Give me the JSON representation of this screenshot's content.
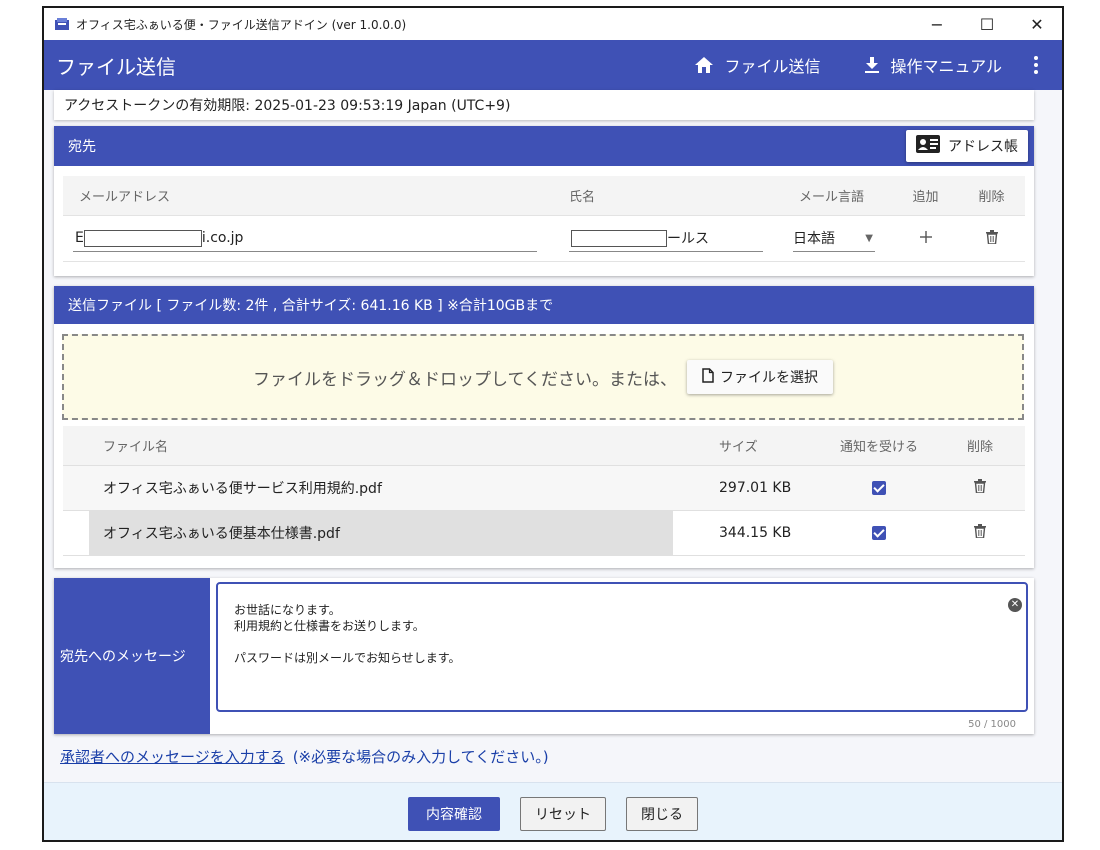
{
  "window": {
    "title": "オフィス宅ふぁいる便・ファイル送信アドイン (ver 1.0.0.0)",
    "minimize": "−",
    "maximize": "☐",
    "close": "✕"
  },
  "appbar": {
    "title": "ファイル送信",
    "nav_send": "ファイル送信",
    "nav_manual": "操作マニュアル"
  },
  "token": {
    "text": "アクセストークンの有効期限: 2025-01-23 09:53:19 Japan (UTC+9)"
  },
  "recipients": {
    "header": "宛先",
    "address_book": "アドレス帳",
    "columns": {
      "email": "メールアドレス",
      "name": "氏名",
      "lang": "メール言語",
      "add": "追加",
      "del": "削除"
    },
    "rows": [
      {
        "email_prefix": "E",
        "email_suffix": "i.co.jp",
        "name_suffix": "ールス",
        "lang": "日本語"
      }
    ]
  },
  "files": {
    "header": "送信ファイル [ ファイル数: 2件 , 合計サイズ: 641.16 KB ] ※合計10GBまで",
    "drop_text": "ファイルをドラッグ＆ドロップしてください。または、",
    "select_button": "ファイルを選択",
    "columns": {
      "name": "ファイル名",
      "size": "サイズ",
      "notify": "通知を受ける",
      "del": "削除"
    },
    "rows": [
      {
        "name": "オフィス宅ふぁいる便サービス利用規約.pdf",
        "size": "297.01 KB",
        "notify": true
      },
      {
        "name": "オフィス宅ふぁいる便基本仕様書.pdf",
        "size": "344.15 KB",
        "notify": true
      }
    ]
  },
  "message": {
    "label": "宛先へのメッセージ",
    "body": "お世話になります。\n利用規約と仕様書をお送りします。\n\nパスワードは別メールでお知らせします。",
    "counter": "50 / 1000"
  },
  "approver": {
    "link": "承認者へのメッセージを入力する",
    "hint": "(※必要な場合のみ入力してください。)"
  },
  "footer": {
    "confirm": "内容確認",
    "reset": "リセット",
    "close": "閉じる"
  },
  "colors": {
    "primary": "#3f51b5",
    "dropzone": "#fdfbe7",
    "footer": "#e8f3fc"
  }
}
